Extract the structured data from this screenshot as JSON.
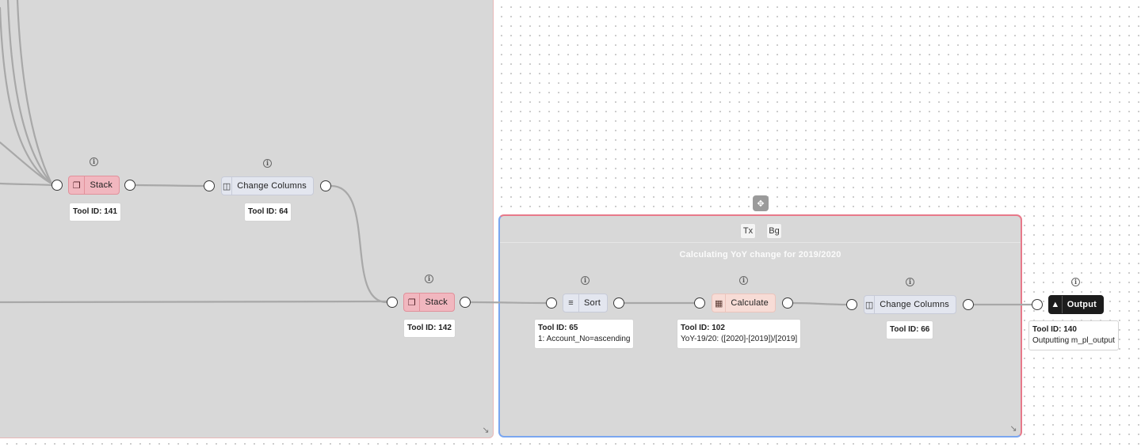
{
  "containers": {
    "right": {
      "title": "Calculating YoY change for 2019/2020",
      "text_style_button": "Tx",
      "background_style_button": "Bg"
    }
  },
  "tools": {
    "stack_141": {
      "label": "Stack",
      "icon": "stack-icon",
      "tool_id": "Tool ID: 141"
    },
    "change_columns_64": {
      "label": "Change Columns",
      "icon": "columns-icon",
      "tool_id": "Tool ID: 64"
    },
    "stack_142": {
      "label": "Stack",
      "icon": "stack-icon",
      "tool_id": "Tool ID: 142"
    },
    "sort_65": {
      "label": "Sort",
      "icon": "sort-icon",
      "tool_id": "Tool ID: 65",
      "detail": "1: Account_No=ascending"
    },
    "calculate_102": {
      "label": "Calculate",
      "icon": "calculator-icon",
      "tool_id": "Tool ID: 102",
      "detail": "YoY-19/20: ([2020]-[2019])/[2019]"
    },
    "change_columns_66": {
      "label": "Change Columns",
      "icon": "columns-icon",
      "tool_id": "Tool ID: 66"
    },
    "output_140": {
      "label": "Output",
      "icon": "upload-icon",
      "tool_id": "Tool ID: 140",
      "detail": "Outputting m_pl_output"
    }
  },
  "colors": {
    "canvas": "#ffffff",
    "container_fill": "#d8d8d8",
    "stack_tool": "#f1b7bf",
    "prep_tool": "#e3e6ef",
    "calculate_tool": "#f7dcd6",
    "output_tool": "#1c1c1c",
    "wire": "#a8a8a8",
    "container_border_top": "#e8798a",
    "container_border_bottom": "#7aa6f0"
  }
}
